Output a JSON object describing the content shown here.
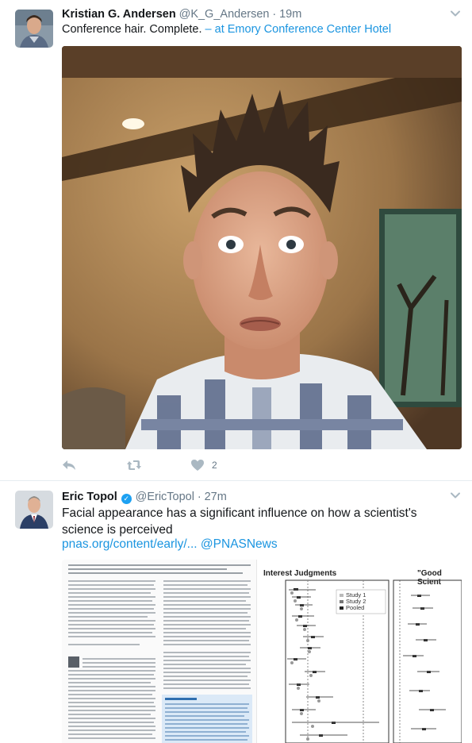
{
  "tweets": [
    {
      "name": "Kristian G. Andersen",
      "handle": "@K_G_Andersen",
      "separator": "·",
      "time": "19m",
      "text": "Conference hair. Complete.",
      "location": " – at Emory Conference Center Hotel",
      "reply_count": "",
      "retweet_count": "",
      "like_count": "2"
    },
    {
      "name": "Eric Topol",
      "handle": "@EricTopol",
      "separator": "·",
      "time": "27m",
      "text": "Facial appearance has a significant influence on how a scientist's science is perceived",
      "link_url": "pnas.org/content/early/...",
      "mention": "@PNASNews",
      "figure": {
        "panel1_title": "Interest Judgments",
        "panel2_title": "\"Good Scient",
        "legend": [
          "Study 1",
          "Study 2",
          "Pooled"
        ]
      }
    }
  ],
  "icons": [
    "caret-down-icon",
    "reply-icon",
    "retweet-icon",
    "heart-icon",
    "verified-badge-icon"
  ],
  "colors": {
    "link": "#1b95e0",
    "muted": "#657786",
    "action_icon": "#aab8c2",
    "verified": "#1da1f2"
  }
}
